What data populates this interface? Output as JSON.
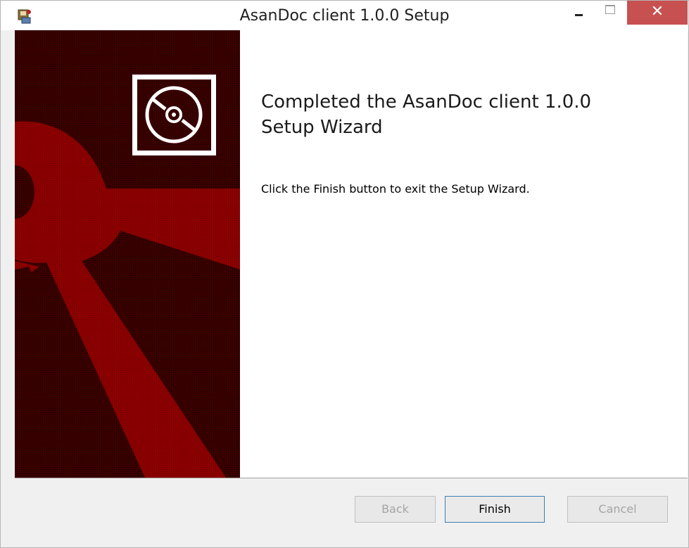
{
  "window": {
    "title": "AsanDoc client 1.0.0 Setup",
    "controls": {
      "minimize_icon": "minimize-icon",
      "maximize_icon": "maximize-icon",
      "close_glyph": "✕"
    }
  },
  "wizard": {
    "heading_line1": "Completed the AsanDoc client 1.0.0",
    "heading_line2": "Setup Wizard",
    "body": "Click the Finish button to exit the Setup Wizard."
  },
  "buttons": {
    "back": "Back",
    "finish": "Finish",
    "cancel": "Cancel"
  },
  "colors": {
    "banner_dark": "#3a0000",
    "banner_red": "#8b0000",
    "close_button": "#c75050"
  }
}
